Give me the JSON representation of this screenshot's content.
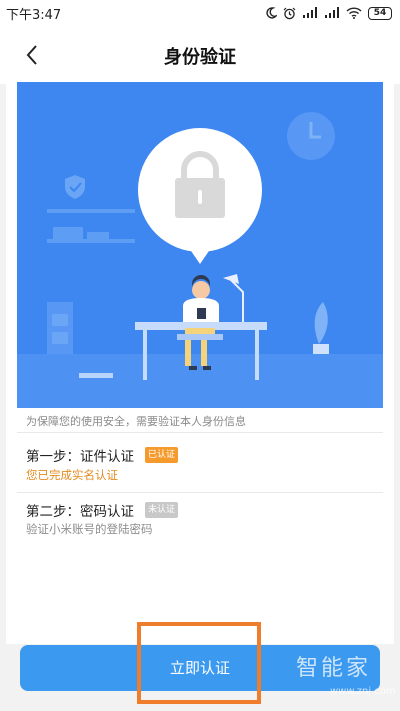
{
  "status_bar": {
    "time": "下午3:47",
    "battery": "54",
    "icons": [
      "moon-icon",
      "alarm-icon",
      "signal-icon",
      "signal-icon",
      "wifi-icon",
      "battery-icon"
    ]
  },
  "nav": {
    "title": "身份验证",
    "back_icon": "chevron-left-icon"
  },
  "hero": {
    "illustration": "person-at-desk-with-lock-illustration",
    "caption": "为保障您的使用安全，需要验证本人身份信息"
  },
  "steps": [
    {
      "title": "第一步：证件认证",
      "badge": "已认证",
      "description": "您已完成实名认证",
      "status": "done"
    },
    {
      "title": "第二步：密码认证",
      "badge": "未认证",
      "description": "验证小米账号的登陆密码",
      "status": "pending"
    }
  ],
  "cta": {
    "label": "立即认证"
  },
  "watermark": {
    "main": "智能家",
    "sub": "www.znj.com"
  },
  "colors": {
    "hero_blue": "#3e86f0",
    "button_blue": "#3b99ef",
    "done_orange": "#f59b2e",
    "pending_gray": "#c8c8c8",
    "highlight_orange": "#f07d2c"
  }
}
